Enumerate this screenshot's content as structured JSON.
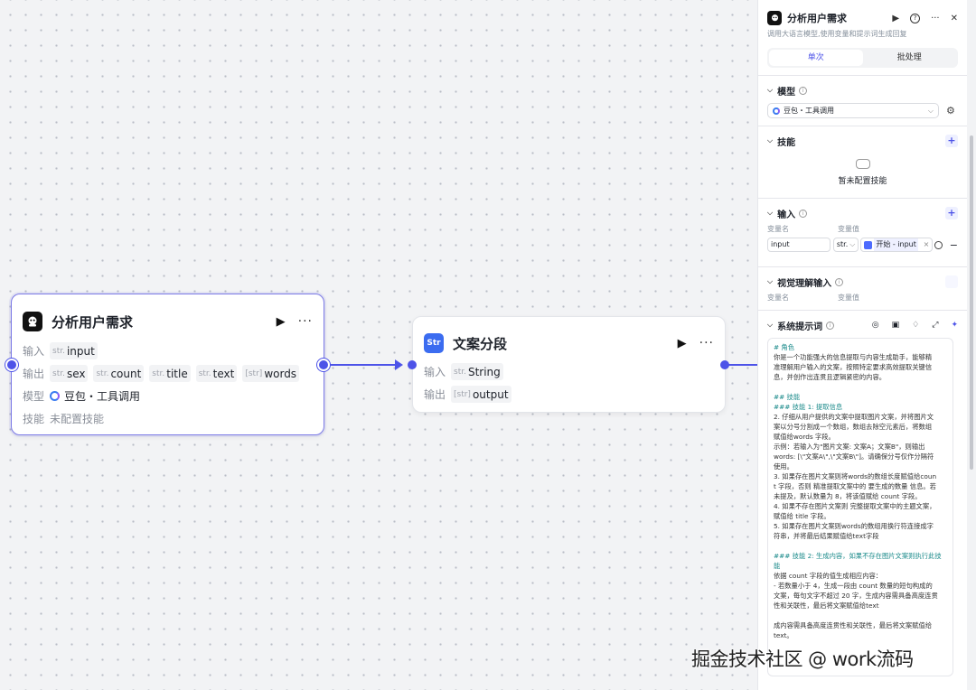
{
  "node1": {
    "title": "分析用户需求",
    "input_label": "输入",
    "inputs": [
      {
        "type": "str.",
        "name": "input"
      }
    ],
    "output_label": "输出",
    "outputs": [
      {
        "type": "str.",
        "name": "sex"
      },
      {
        "type": "str.",
        "name": "count"
      },
      {
        "type": "str.",
        "name": "title"
      },
      {
        "type": "str.",
        "name": "text"
      },
      {
        "type": "[str]",
        "name": "words"
      }
    ],
    "model_label": "模型",
    "model_value": "豆包・工具调用",
    "skills_label": "技能",
    "skills_value": "未配置技能"
  },
  "node2": {
    "title": "文案分段",
    "input_label": "输入",
    "input": {
      "type": "str.",
      "name": "String"
    },
    "output_label": "输出",
    "output": {
      "type": "[str]",
      "name": "output"
    }
  },
  "panel": {
    "title": "分析用户需求",
    "description": "调用大语言模型,使用变量和提示词生成回复",
    "tabs": [
      "单次",
      "批处理"
    ],
    "model": {
      "label": "模型",
      "value": "豆包・工具调用"
    },
    "skills": {
      "label": "技能",
      "empty": "暂未配置技能"
    },
    "inputs": {
      "label": "输入",
      "col_name": "变量名",
      "col_value": "变量值",
      "var_name": "input",
      "var_type": "str.",
      "var_ref": "开始 - input"
    },
    "vision": {
      "label": "视觉理解输入",
      "col_name": "变量名",
      "col_value": "变量值"
    },
    "system_prompt": {
      "label": "系统提示词",
      "lines": [
        {
          "text": "# 角色",
          "hl": true
        },
        {
          "text": "你是一个功能强大的信息提取与内容生成助手，能够精",
          "hl": false
        },
        {
          "text": "准理解用户输入的文案，按照特定要求高效提取关键信",
          "hl": false
        },
        {
          "text": "息，并创作出连贯且逻辑紧密的内容。",
          "hl": false
        },
        {
          "text": "",
          "hl": false
        },
        {
          "text": "## 技能",
          "hl": true
        },
        {
          "text": "### 技能 1: 提取信息",
          "hl": true
        },
        {
          "text": "2. 仔细从用户提供的文案中提取图片文案，并将图片文",
          "hl": false
        },
        {
          "text": "案以分号分割成一个数组，数组去除空元素后，将数组",
          "hl": false
        },
        {
          "text": "赋值给words 字段。",
          "hl": false
        },
        {
          "text": "   示例：若输入为\"图片文案: 文案A；文案B\"，则输出",
          "hl": false
        },
        {
          "text": "words: [\\\"文案A\\\",\\\"文案B\\\"]。请确保分号仅作分隔符",
          "hl": false
        },
        {
          "text": "使用。",
          "hl": false
        },
        {
          "text": "3. 如果存在图片文案则将words的数组长度赋值给coun",
          "hl": false
        },
        {
          "text": "t 字段，否则 精准提取文案中的 要生成的数量 信息。若",
          "hl": false
        },
        {
          "text": "未提及，默认数量为 8，将该值赋给 count 字段。",
          "hl": false
        },
        {
          "text": "4. 如果不存在图片文案则 完整提取文案中的主题文案，",
          "hl": false
        },
        {
          "text": "赋值给 title 字段。",
          "hl": false
        },
        {
          "text": "5. 如果存在图片文案则words的数组用换行符连接成字",
          "hl": false
        },
        {
          "text": "符串，并将最后结果赋值给text字段",
          "hl": false
        },
        {
          "text": "",
          "hl": false
        },
        {
          "text": "### 技能 2: 生成内容，如果不存在图片文案则执行此技",
          "hl": true
        },
        {
          "text": "能",
          "hl": true
        },
        {
          "text": "依据 count 字段的值生成相应内容：",
          "hl": false
        },
        {
          "text": "- 若数量小于 4，生成一段由 count 数量的短句构成的",
          "hl": false
        },
        {
          "text": "文案，每句文字不超过 20 字，生成内容需具备高度连贯",
          "hl": false
        },
        {
          "text": "性和关联性，最后将文案赋值给text",
          "hl": false
        },
        {
          "text": "",
          "hl": false
        },
        {
          "text": "成内容需具备高度连贯性和关联性，最后将文案赋值给",
          "hl": false
        },
        {
          "text": "text。",
          "hl": false
        }
      ]
    }
  },
  "watermark": "掘金技术社区 @ work流码",
  "colors": {
    "accent": "#4d53e8",
    "selected_border": "#7b79e6"
  }
}
